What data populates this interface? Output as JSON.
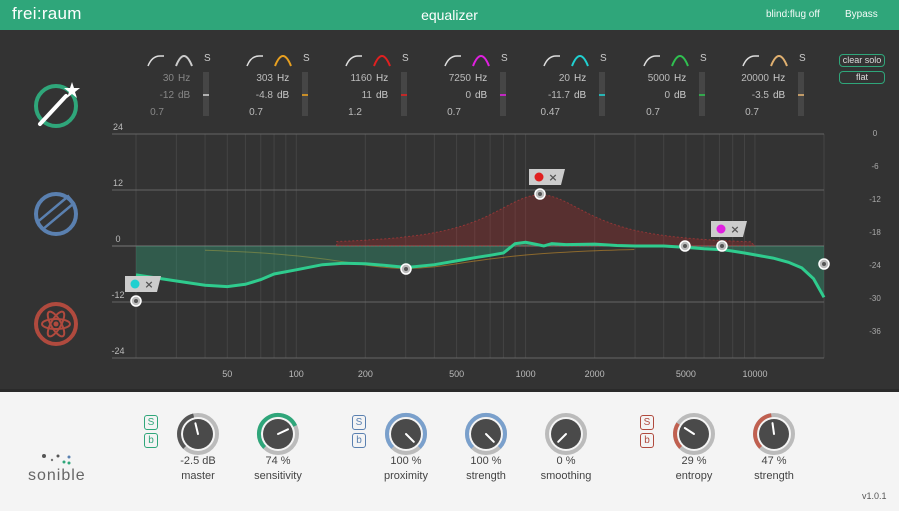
{
  "header": {
    "brand": "frei:raum",
    "title": "equalizer",
    "blind_label": "blind:flug off",
    "bypass_label": "Bypass"
  },
  "side_buttons": {
    "clear_solo": "clear solo",
    "flat": "flat"
  },
  "bands": [
    {
      "freq": "30",
      "freq_unit": "Hz",
      "gain": "-12",
      "gain_unit": "dB",
      "q": "0.7",
      "solo": "S",
      "color": "#cccccc",
      "icon": "low-cut-icon",
      "active": false
    },
    {
      "freq": "303",
      "freq_unit": "Hz",
      "gain": "-4.8",
      "gain_unit": "dB",
      "q": "0.7",
      "solo": "S",
      "color": "#e8a020",
      "icon": "bell-icon",
      "active": true
    },
    {
      "freq": "1160",
      "freq_unit": "Hz",
      "gain": "11",
      "gain_unit": "dB",
      "q": "1.2",
      "solo": "S",
      "color": "#e02020",
      "icon": "bell-icon",
      "active": true
    },
    {
      "freq": "7250",
      "freq_unit": "Hz",
      "gain": "0",
      "gain_unit": "dB",
      "q": "0.7",
      "solo": "S",
      "color": "#e020e0",
      "icon": "bell-icon",
      "active": true
    },
    {
      "freq": "20",
      "freq_unit": "Hz",
      "gain": "-11.7",
      "gain_unit": "dB",
      "q": "0.47",
      "solo": "S",
      "color": "#20d0d0",
      "icon": "bell-icon",
      "active": true
    },
    {
      "freq": "5000",
      "freq_unit": "Hz",
      "gain": "0",
      "gain_unit": "dB",
      "q": "0.7",
      "solo": "S",
      "color": "#30c050",
      "icon": "high-shelf-icon",
      "active": true
    },
    {
      "freq": "20000",
      "freq_unit": "Hz",
      "gain": "-3.5",
      "gain_unit": "dB",
      "q": "0.7",
      "solo": "S",
      "color": "#e0b070",
      "icon": "high-shelf-icon",
      "active": true
    }
  ],
  "graph": {
    "y_labels": [
      "24",
      "12",
      "0",
      "-12",
      "-24"
    ],
    "x_labels": [
      "50",
      "100",
      "200",
      "500",
      "1000",
      "2000",
      "5000",
      "10000"
    ],
    "right_labels": [
      "0",
      "-6",
      "-12",
      "-18",
      "-24",
      "-30",
      "-36"
    ]
  },
  "bottom": {
    "s_label": "S",
    "b_label": "b",
    "knobs": [
      {
        "value": "-2.5 dB",
        "label": "master",
        "fraction": 0.45,
        "color": "#555555"
      },
      {
        "value": "74 %",
        "label": "sensitivity",
        "fraction": 0.74,
        "color": "#2fa67a"
      },
      {
        "value": "100 %",
        "label": "proximity",
        "fraction": 1.0,
        "color": "#7aa0cc"
      },
      {
        "value": "100 %",
        "label": "strength",
        "fraction": 1.0,
        "color": "#7aa0cc"
      },
      {
        "value": "0 %",
        "label": "smoothing",
        "fraction": 0.0,
        "color": "#555555"
      },
      {
        "value": "29 %",
        "label": "entropy",
        "fraction": 0.29,
        "color": "#c06050"
      },
      {
        "value": "47 %",
        "label": "strength",
        "fraction": 0.47,
        "color": "#c06050"
      }
    ],
    "logo": "sonible",
    "version": "v1.0.1"
  },
  "colors": {
    "accent": "#2fa67a",
    "blue": "#5a80b0",
    "red": "#b04a3e"
  }
}
